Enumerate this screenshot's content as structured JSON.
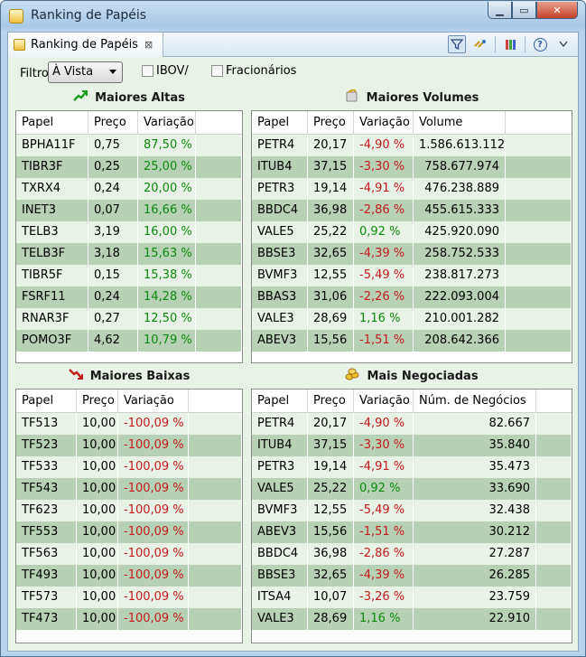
{
  "window": {
    "title": "Ranking de Papéis"
  },
  "tab": {
    "label": "Ranking de Papéis",
    "close": "⊠"
  },
  "filter": {
    "label": "Filtro",
    "selected": "À Vista",
    "ibov_label": "IBOV/",
    "fracionarios_label": "Fracionários"
  },
  "maiores_altas": {
    "title": "Maiores Altas",
    "headers": [
      "Papel",
      "Preço",
      "Variação"
    ],
    "rows": [
      [
        "BPHA11F",
        "0,75",
        "87,50 %"
      ],
      [
        "TIBR3F",
        "0,25",
        "25,00 %"
      ],
      [
        "TXRX4",
        "0,24",
        "20,00 %"
      ],
      [
        "INET3",
        "0,07",
        "16,66 %"
      ],
      [
        "TELB3",
        "3,19",
        "16,00 %"
      ],
      [
        "TELB3F",
        "3,18",
        "15,63 %"
      ],
      [
        "TIBR5F",
        "0,15",
        "15,38 %"
      ],
      [
        "FSRF11",
        "0,24",
        "14,28 %"
      ],
      [
        "RNAR3F",
        "0,27",
        "12,50 %"
      ],
      [
        "POMO3F",
        "4,62",
        "10,79 %"
      ]
    ]
  },
  "maiores_volumes": {
    "title": "Maiores Volumes",
    "headers": [
      "Papel",
      "Preço",
      "Variação",
      "Volume"
    ],
    "rows": [
      [
        "PETR4",
        "20,17",
        "-4,90 %",
        "1.586.613.112"
      ],
      [
        "ITUB4",
        "37,15",
        "-3,30 %",
        "758.677.974"
      ],
      [
        "PETR3",
        "19,14",
        "-4,91 %",
        "476.238.889"
      ],
      [
        "BBDC4",
        "36,98",
        "-2,86 %",
        "455.615.333"
      ],
      [
        "VALE5",
        "25,22",
        "0,92 %",
        "425.920.090"
      ],
      [
        "BBSE3",
        "32,65",
        "-4,39 %",
        "258.752.533"
      ],
      [
        "BVMF3",
        "12,55",
        "-5,49 %",
        "238.817.273"
      ],
      [
        "BBAS3",
        "31,06",
        "-2,26 %",
        "222.093.004"
      ],
      [
        "VALE3",
        "28,69",
        "1,16 %",
        "210.001.282"
      ],
      [
        "ABEV3",
        "15,56",
        "-1,51 %",
        "208.642.366"
      ]
    ]
  },
  "maiores_baixas": {
    "title": "Maiores Baixas",
    "headers": [
      "Papel",
      "Preço",
      "Variação"
    ],
    "rows": [
      [
        "TF513",
        "10,00",
        "-100,09 %"
      ],
      [
        "TF523",
        "10,00",
        "-100,09 %"
      ],
      [
        "TF533",
        "10,00",
        "-100,09 %"
      ],
      [
        "TF543",
        "10,00",
        "-100,09 %"
      ],
      [
        "TF623",
        "10,00",
        "-100,09 %"
      ],
      [
        "TF553",
        "10,00",
        "-100,09 %"
      ],
      [
        "TF563",
        "10,00",
        "-100,09 %"
      ],
      [
        "TF493",
        "10,00",
        "-100,09 %"
      ],
      [
        "TF573",
        "10,00",
        "-100,09 %"
      ],
      [
        "TF473",
        "10,00",
        "-100,09 %"
      ]
    ]
  },
  "mais_negociadas": {
    "title": "Mais Negociadas",
    "headers": [
      "Papel",
      "Preço",
      "Variação",
      "Núm. de Negócios"
    ],
    "rows": [
      [
        "PETR4",
        "20,17",
        "-4,90 %",
        "82.667"
      ],
      [
        "ITUB4",
        "37,15",
        "-3,30 %",
        "35.840"
      ],
      [
        "PETR3",
        "19,14",
        "-4,91 %",
        "35.473"
      ],
      [
        "VALE5",
        "25,22",
        "0,92 %",
        "33.690"
      ],
      [
        "BVMF3",
        "12,55",
        "-5,49 %",
        "32.438"
      ],
      [
        "ABEV3",
        "15,56",
        "-1,51 %",
        "30.212"
      ],
      [
        "BBDC4",
        "36,98",
        "-2,86 %",
        "27.287"
      ],
      [
        "BBSE3",
        "32,65",
        "-4,39 %",
        "26.285"
      ],
      [
        "ITSA4",
        "10,07",
        "-3,26 %",
        "23.759"
      ],
      [
        "VALE3",
        "28,69",
        "1,16 %",
        "22.910"
      ]
    ]
  },
  "colors": {
    "positive": "#0b8a0b",
    "negative": "#c41a1a",
    "row_even": "#b7d1b5",
    "row_odd": "#e8f2e6"
  }
}
